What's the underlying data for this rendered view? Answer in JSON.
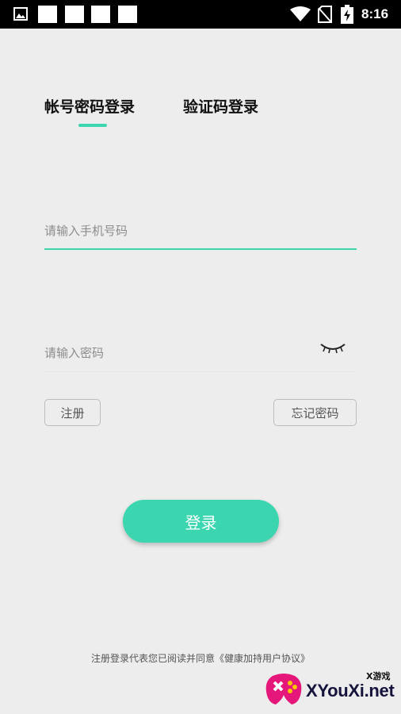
{
  "status_bar": {
    "time": "8:16",
    "icons": [
      "image-icon",
      "notification-square-icon",
      "notification-square-icon",
      "notification-square-icon",
      "notification-square-icon",
      "wifi-icon",
      "no-sim-icon",
      "battery-charging-icon"
    ]
  },
  "tabs": [
    {
      "label": "帐号密码登录",
      "active": true
    },
    {
      "label": "验证码登录",
      "active": false
    }
  ],
  "form": {
    "phone_placeholder": "请输入手机号码",
    "phone_value": "",
    "password_placeholder": "请输入密码",
    "password_value": "",
    "password_toggle_icon": "eye-closed-icon"
  },
  "buttons": {
    "register": "注册",
    "forgot_password": "忘记密码",
    "login": "登录"
  },
  "agreement": {
    "prefix": "注册登录代表您已阅读并同意",
    "link": "《健康加持用户协议》"
  },
  "watermark": {
    "small_text": "X游戏",
    "brand": "XYouXi.net"
  },
  "colors": {
    "accent": "#3bd6b0",
    "background": "#ededed",
    "status_bar": "#000000"
  }
}
